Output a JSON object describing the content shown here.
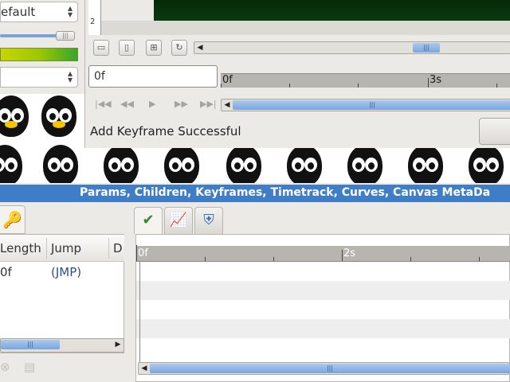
{
  "top_left": {
    "combo1_value": "efault",
    "combo2_value": ""
  },
  "canvas": {
    "ruler_v_label": "2",
    "time_field_value": "0f",
    "ruler_labels": [
      "0f",
      "3s"
    ],
    "status_message": "Add Keyframe Successful"
  },
  "params_bar": {
    "title": "Params, Children, Keyframes, Timetrack, Curves, Canvas MetaDa"
  },
  "keyframes": {
    "columns": [
      "Length",
      "Jump",
      "D"
    ],
    "rows": [
      {
        "length": "0f",
        "jump": "(JMP)",
        "d": ""
      }
    ]
  },
  "timetrack": {
    "ruler_labels": [
      "0f",
      "2s"
    ]
  },
  "colors": {
    "accent": "#3f7ec7",
    "scroll_thumb": "#7aa6dc",
    "canvas_bg": "#062a08"
  }
}
